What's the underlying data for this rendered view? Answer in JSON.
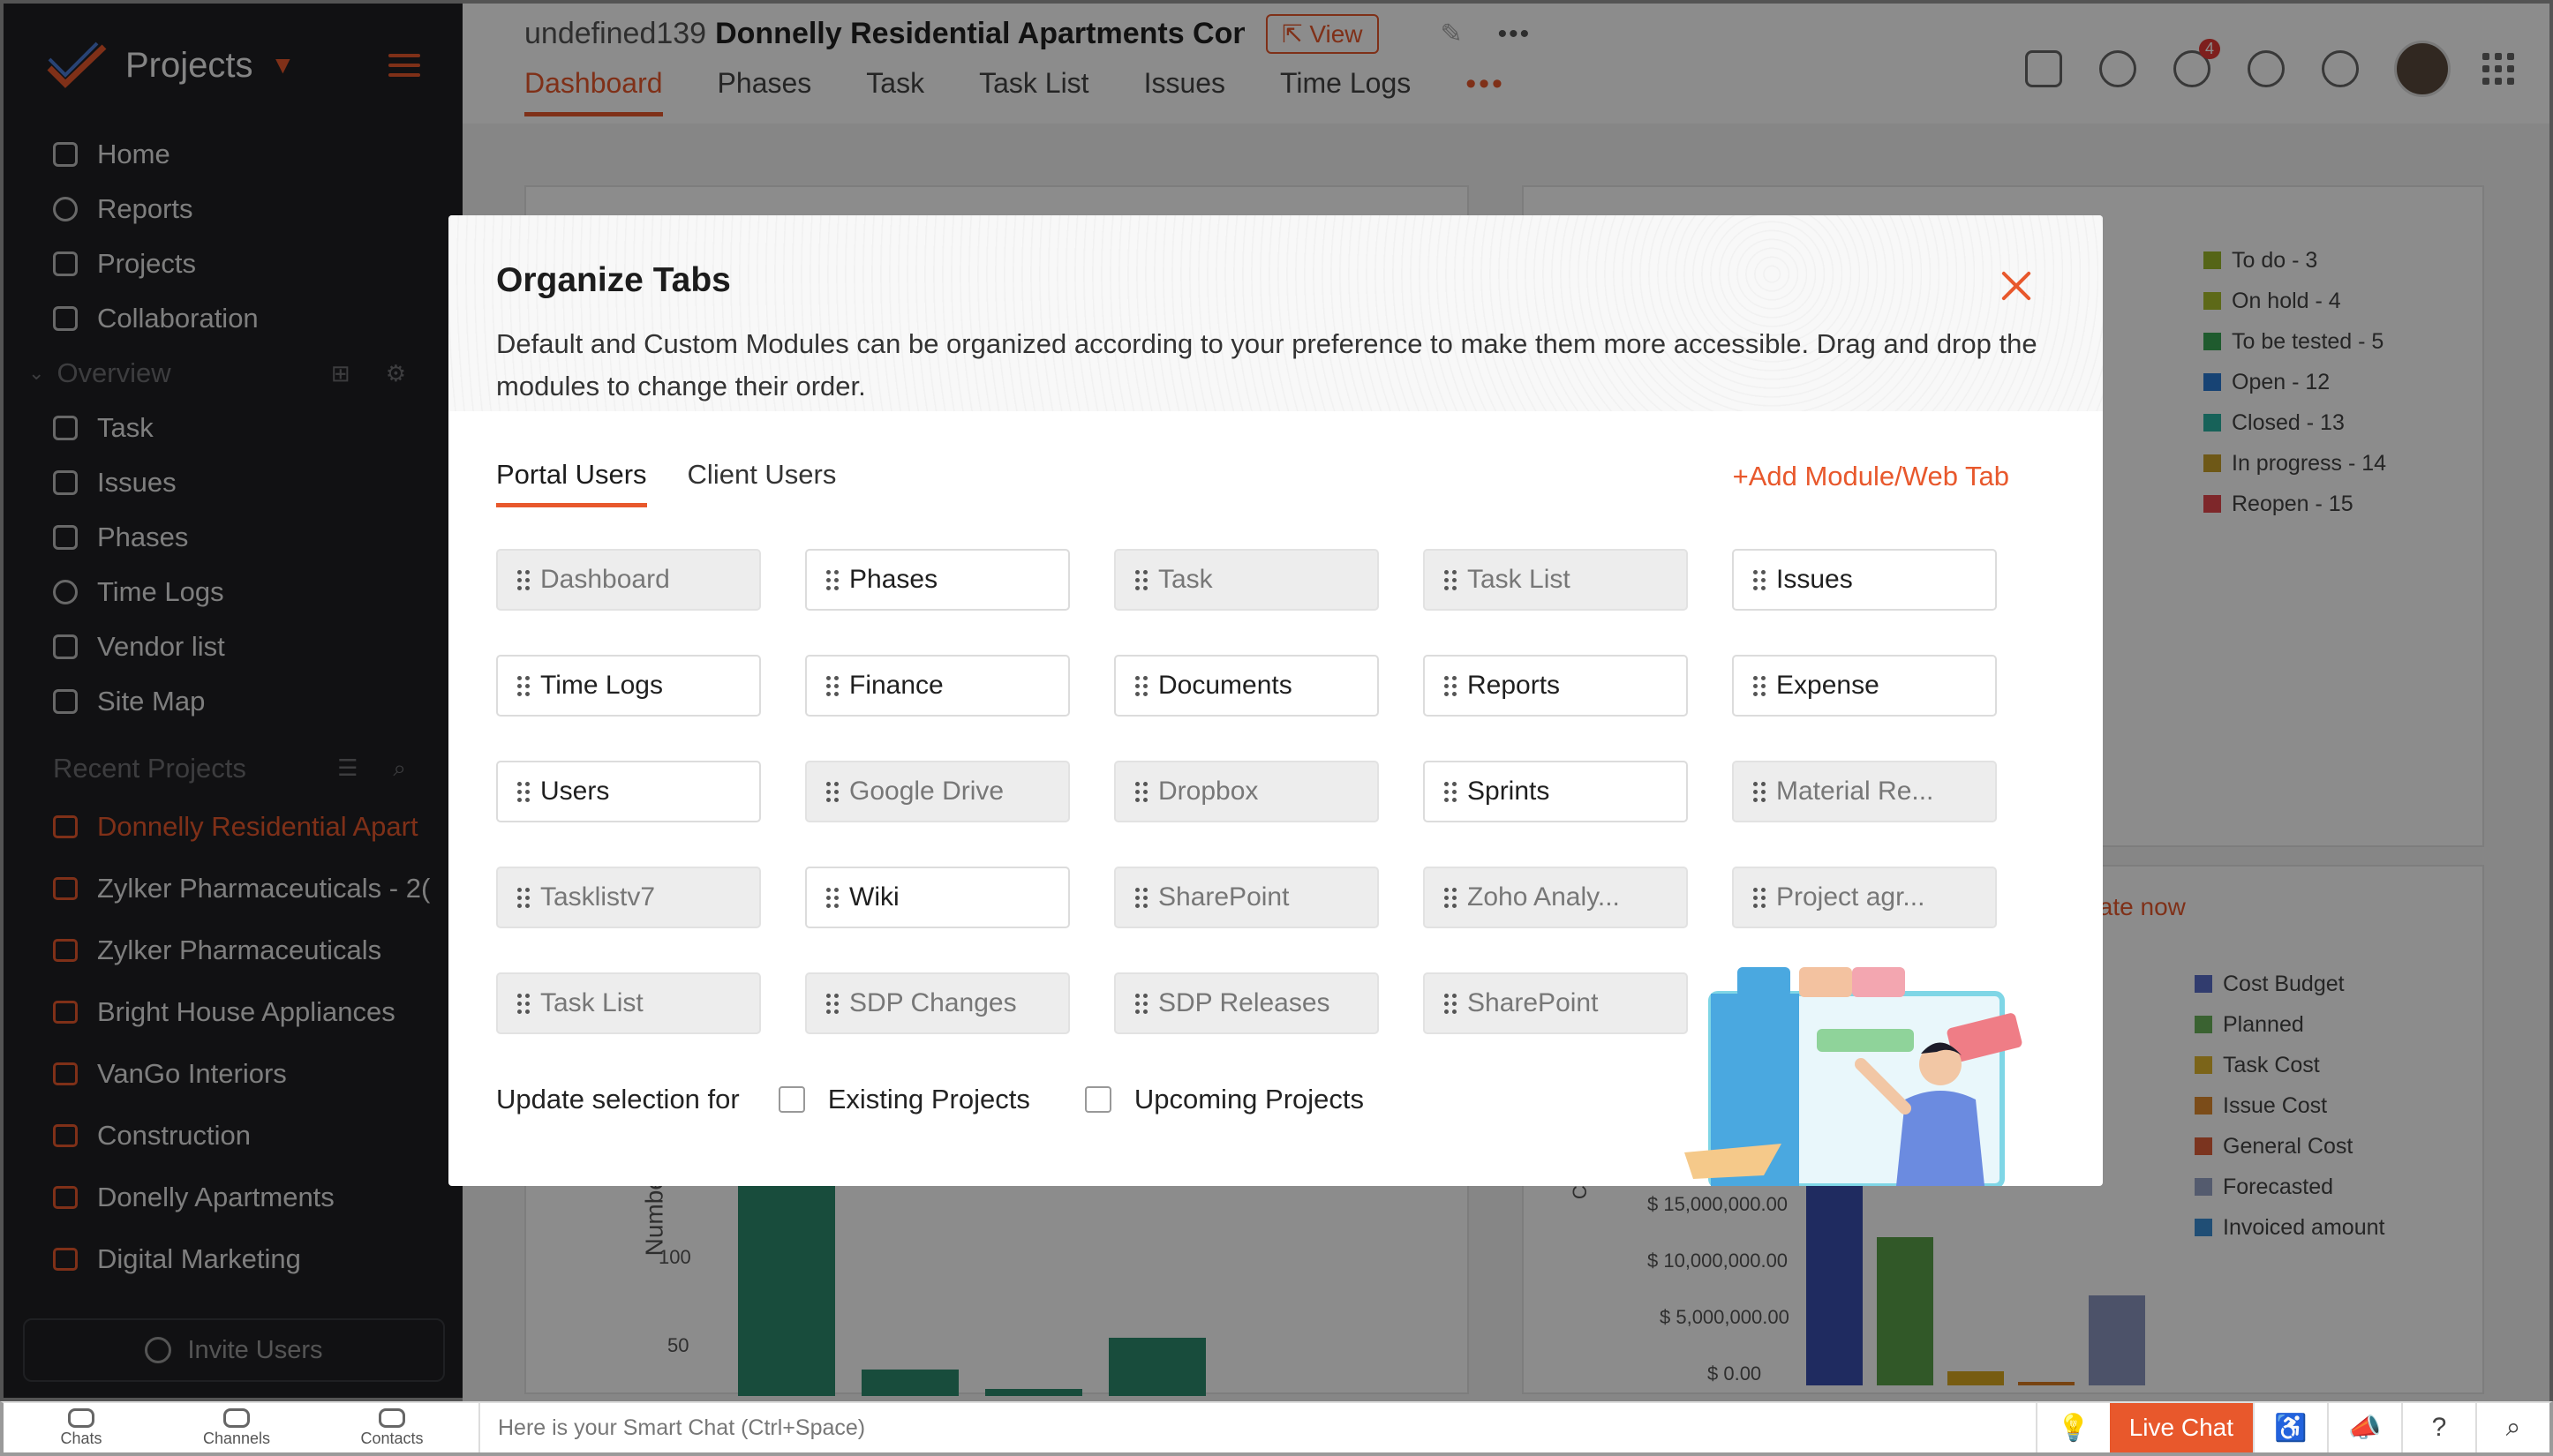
{
  "sidebar": {
    "title": "Projects",
    "nav": [
      {
        "label": "Home",
        "icon": "home-icon"
      },
      {
        "label": "Reports",
        "icon": "reports-icon"
      },
      {
        "label": "Projects",
        "icon": "projects-icon"
      },
      {
        "label": "Collaboration",
        "icon": "collaboration-icon"
      }
    ],
    "overview_label": "Overview",
    "overview_items": [
      {
        "label": "Task",
        "icon": "task-icon"
      },
      {
        "label": "Issues",
        "icon": "issues-icon"
      },
      {
        "label": "Phases",
        "icon": "phases-icon"
      },
      {
        "label": "Time Logs",
        "icon": "timer-icon"
      },
      {
        "label": "Vendor list",
        "icon": "vendor-icon"
      },
      {
        "label": "Site Map",
        "icon": "sitemap-icon"
      }
    ],
    "recent_label": "Recent Projects",
    "recent": [
      "Donnelly Residential Apart",
      "Zylker Pharmaceuticals - 2(",
      "Zylker Pharmaceuticals",
      "Bright House Appliances",
      "VanGo Interiors",
      "Construction",
      "Donelly Apartments",
      "Digital Marketing"
    ],
    "invite_label": "Invite Users"
  },
  "topbar": {
    "project_prefix": "undefined139",
    "project_name": "Donnelly Residential Apartments Cons",
    "view_label": "View",
    "tabs": [
      "Dashboard",
      "Phases",
      "Task",
      "Task List",
      "Issues",
      "Time Logs"
    ],
    "more_tabs": "•••",
    "notification_count": "4"
  },
  "dashboard": {
    "status_legend": [
      "To do - 3",
      "On hold - 4",
      "To be tested - 5",
      "Open - 12",
      "Closed - 13",
      "In progress - 14",
      "Reopen - 15"
    ],
    "status_colors": [
      "#9bb92b",
      "#a9bf2c",
      "#3aa655",
      "#2b7bd3",
      "#2ab3a3",
      "#c9a02a",
      "#e5484d"
    ],
    "cost_legend": [
      "Cost Budget",
      "Planned",
      "Task Cost",
      "Issue Cost",
      "General Cost",
      "Forecasted",
      "Invoiced amount"
    ],
    "cost_colors": [
      "#5a6ec8",
      "#6bb35a",
      "#e0b62e",
      "#e08a2e",
      "#e0603a",
      "#9aa6c8",
      "#3b8fd6"
    ],
    "update_now": "ulate now",
    "y_ticks_left": [
      "100",
      "50"
    ],
    "y_label_left": "Number of",
    "y_ticks_right": [
      "$ 15,000,000.00",
      "$ 10,000,000.00",
      "$ 5,000,000.00",
      "$ 0.00"
    ],
    "y_label_right": "Co"
  },
  "modal": {
    "title": "Organize Tabs",
    "description": "Default and Custom Modules can be organized according to your preference to make them more accessible. Drag and drop the modules to change their order.",
    "tabs": [
      "Portal Users",
      "Client Users"
    ],
    "add_module": "+Add Module/Web Tab",
    "modules": [
      {
        "label": "Dashboard",
        "enabled": false
      },
      {
        "label": "Phases",
        "enabled": true
      },
      {
        "label": "Task",
        "enabled": false
      },
      {
        "label": "Task List",
        "enabled": false
      },
      {
        "label": "Issues",
        "enabled": true
      },
      {
        "label": "Time Logs",
        "enabled": true
      },
      {
        "label": "Finance",
        "enabled": true
      },
      {
        "label": "Documents",
        "enabled": true
      },
      {
        "label": "Reports",
        "enabled": true
      },
      {
        "label": "Expense",
        "enabled": true
      },
      {
        "label": "Users",
        "enabled": true
      },
      {
        "label": "Google Drive",
        "enabled": false
      },
      {
        "label": "Dropbox",
        "enabled": false
      },
      {
        "label": "Sprints",
        "enabled": true
      },
      {
        "label": "Material Re...",
        "enabled": false
      },
      {
        "label": "Tasklistv7",
        "enabled": false
      },
      {
        "label": "Wiki",
        "enabled": true
      },
      {
        "label": "SharePoint",
        "enabled": false
      },
      {
        "label": "Zoho Analy...",
        "enabled": false
      },
      {
        "label": "Project agr...",
        "enabled": false
      },
      {
        "label": "Task List",
        "enabled": false
      },
      {
        "label": "SDP Changes",
        "enabled": false
      },
      {
        "label": "SDP Releases",
        "enabled": false
      },
      {
        "label": "SharePoint",
        "enabled": false
      }
    ],
    "update_label": "Update selection for",
    "checkboxes": [
      {
        "label": "Existing Projects",
        "checked": false
      },
      {
        "label": "Upcoming Projects",
        "checked": false
      }
    ]
  },
  "footer": {
    "apps": [
      "Chats",
      "Channels",
      "Contacts"
    ],
    "smart_chat_placeholder": "Here is your Smart Chat (Ctrl+Space)",
    "live_chat": "Live Chat"
  },
  "colors": {
    "accent": "#e8582c",
    "sidebar_bg": "#1f2024"
  }
}
